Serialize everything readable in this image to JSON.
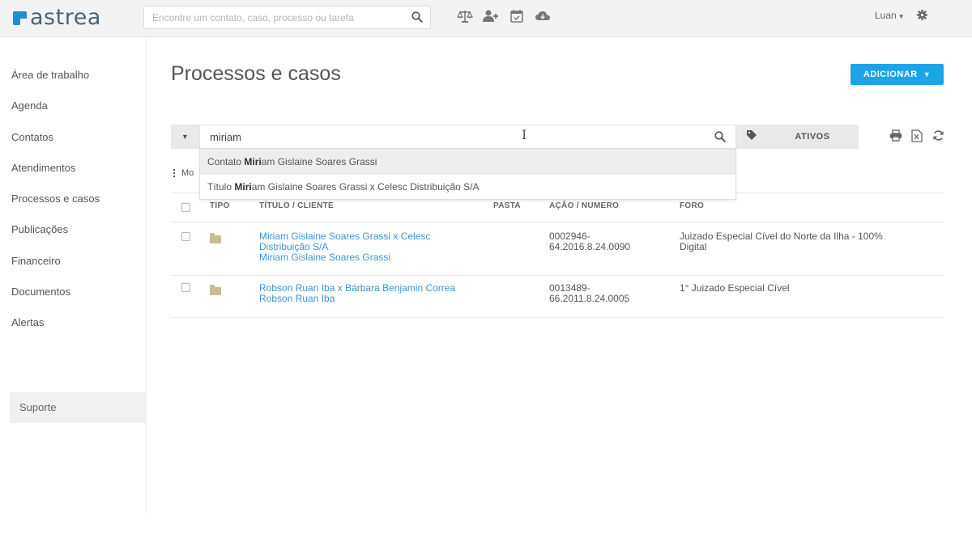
{
  "app": {
    "logo_text": "astrea",
    "brand_color": "#1b8fd6"
  },
  "topbar": {
    "search_placeholder": "Encontre um contato, caso, processo ou tarefa",
    "quick_icons": [
      "scales-icon",
      "add-user-icon",
      "calendar-check-icon",
      "cloud-icon"
    ],
    "user_name": "Luan"
  },
  "sidebar": {
    "items": [
      {
        "label": "Área de trabalho"
      },
      {
        "label": "Agenda"
      },
      {
        "label": "Contatos"
      },
      {
        "label": "Atendimentos"
      },
      {
        "label": "Processos e casos"
      },
      {
        "label": "Publicações"
      },
      {
        "label": "Financeiro"
      },
      {
        "label": "Documentos"
      },
      {
        "label": "Alertas"
      }
    ],
    "support_label": "Suporte"
  },
  "main": {
    "title": "Processos e casos",
    "add_button_label": "ADICIONAR",
    "add_button_color": "#1ca4e8",
    "filter": {
      "query": "miriam",
      "status_label": "ATIVOS"
    },
    "suggestions": [
      {
        "prefix": "Contato ",
        "match": "Miri",
        "suffix": "am Gislaine Soares Grassi"
      },
      {
        "prefix": "Título ",
        "match": "Miri",
        "suffix": "am Gislaine Soares Grassi x Celesc Distribuição S/A"
      }
    ],
    "more_label": "Mo",
    "table": {
      "headers": {
        "tipo": "TIPO",
        "titulo": "TÍTULO / CLIENTE",
        "pasta": "PASTA",
        "acao": "AÇÃO / NUMERO",
        "foro": "FORO"
      },
      "rows": [
        {
          "title_line1": "Miriam Gislaine Soares Grassi x Celesc",
          "title_line2": "Distribuição S/A",
          "client": "Miriam Gislaine Soares Grassi",
          "pasta": "",
          "numero_line1": "0002946-",
          "numero_line2": "64.2016.8.24.0090",
          "foro_line1": "Juizado Especial Cível do Norte da Ilha - 100%",
          "foro_line2": "Digital"
        },
        {
          "title_line1": "Robson Ruan Iba x Bárbara Benjamin Correa",
          "client": "Robson Ruan Iba",
          "pasta": "",
          "numero_line1": "0013489-",
          "numero_line2": "66.2011.8.24.0005",
          "foro_line1": "1° Juizado Especial Cível"
        }
      ]
    }
  }
}
